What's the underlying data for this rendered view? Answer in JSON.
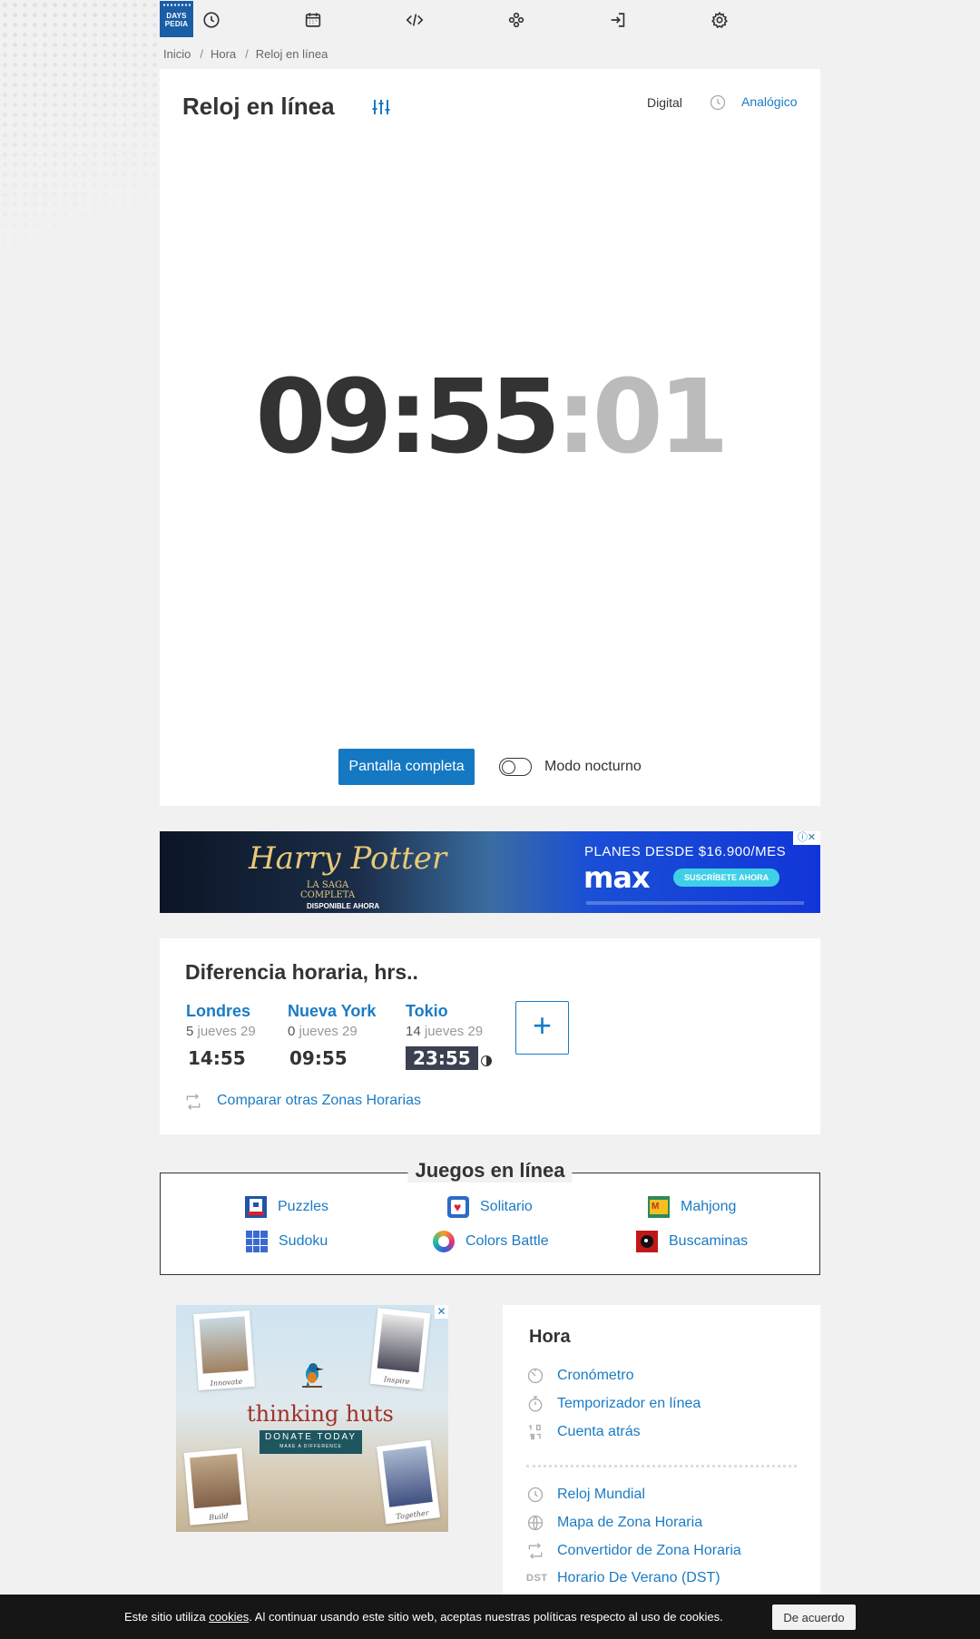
{
  "logo": {
    "line1": "DAYS",
    "line2": "PEDIA"
  },
  "nav": {
    "icons": [
      "clock-icon",
      "calendar-icon",
      "code-icon",
      "gamepad-icon",
      "login-icon",
      "gear-icon"
    ]
  },
  "breadcrumb": {
    "items": [
      "Inicio",
      "Hora",
      "Reloj en línea"
    ]
  },
  "clock": {
    "title": "Reloj en línea",
    "mode_digital": "Digital",
    "mode_analog": "Analógico",
    "time_hm": "09:55",
    "time_sec": ":01",
    "fullscreen_label": "Pantalla completa",
    "night_mode_label": "Modo nocturno"
  },
  "banner_ad": {
    "title": "Harry Potter",
    "subtitle_1": "LA SAGA",
    "subtitle_2": "COMPLETA",
    "available": "DISPONIBLE AHORA",
    "plan": "PLANES DESDE $16.900/MES",
    "brand": "max",
    "cta": "SUSCRÍBETE AHORA"
  },
  "time_difference": {
    "title": "Diferencia horaria, hrs..",
    "cities": [
      {
        "name": "Londres",
        "offset": "5",
        "date": " jueves 29",
        "time": "14:55",
        "night": false
      },
      {
        "name": "Nueva York",
        "offset": "0",
        "date": " jueves 29",
        "time": "09:55",
        "night": false
      },
      {
        "name": "Tokio",
        "offset": "14",
        "date": " jueves 29",
        "time": "23:55",
        "night": true
      }
    ],
    "add_label": "+",
    "compare_link": "Comparar otras Zonas Horarias"
  },
  "games": {
    "title": "Juegos en línea",
    "items": [
      {
        "label": "Puzzles",
        "icon": "puzzle-icon"
      },
      {
        "label": "Solitario",
        "icon": "solitaire-icon"
      },
      {
        "label": "Mahjong",
        "icon": "mahjong-icon"
      },
      {
        "label": "Sudoku",
        "icon": "sudoku-icon"
      },
      {
        "label": "Colors Battle",
        "icon": "colors-battle-icon"
      },
      {
        "label": "Buscaminas",
        "icon": "minesweeper-icon"
      }
    ]
  },
  "side_ad": {
    "name": "thinking huts",
    "donate": "DONATE TODAY",
    "donate_sub": "MAKE A DIFFERENCE",
    "captions": [
      "Innovate",
      "Inspire",
      "Build",
      "Together"
    ]
  },
  "hora": {
    "title": "Hora",
    "links_top": [
      "Cronómetro",
      "Temporizador en línea",
      "Cuenta atrás"
    ],
    "links_bottom": [
      "Reloj Mundial",
      "Mapa de Zona Horaria",
      "Convertidor de Zona Horaria",
      "Horario De Verano (DST)"
    ],
    "dst_tag": "DST"
  },
  "cookie": {
    "text_1": "Este sitio utiliza ",
    "link": "cookies",
    "text_2": ". Al continuar usando este sitio web, aceptas nuestras políticas respecto al uso de cookies.",
    "accept": "De acuerdo"
  },
  "colors": {
    "accent": "#1a7bc4",
    "button": "#1478c2",
    "logo": "#1a5ea8",
    "cookie_bar": "#161616"
  }
}
